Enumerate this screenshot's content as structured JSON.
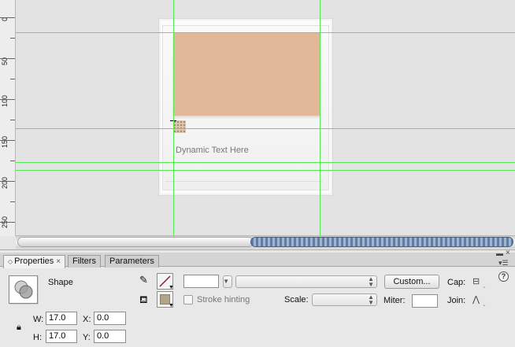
{
  "ruler": {
    "labels": [
      "0",
      "50",
      "100",
      "150",
      "200",
      "250"
    ]
  },
  "stage": {
    "dynamic_text": "Dynamic Text Here"
  },
  "panel": {
    "tabs": [
      {
        "label": "Properties",
        "active": true,
        "closable": true
      },
      {
        "label": "Filters",
        "active": false
      },
      {
        "label": "Parameters",
        "active": false
      }
    ],
    "close_glyph": "×",
    "object_type": "Shape",
    "stroke_hinting_label": "Stroke hinting",
    "scale_label": "Scale:",
    "custom_button": "Custom...",
    "cap_label": "Cap:",
    "miter_label": "Miter:",
    "join_label": "Join:",
    "help_glyph": "?",
    "w_label": "W:",
    "w_value": "17.0",
    "h_label": "H:",
    "h_value": "17.0",
    "x_label": "X:",
    "x_value": "0.0",
    "y_label": "Y:",
    "y_value": "0.0",
    "stroke_color": "#8a1c2e",
    "fill_color": "#b2a48a"
  },
  "colors": {
    "guide": "#55e855",
    "photo": "#e2b89b",
    "scroll_thumb": "#5e7ea9"
  },
  "icons": [
    "pencil-icon",
    "paint-bucket-icon",
    "lock-icon",
    "help-icon",
    "close-icon",
    "panel-menu-icon",
    "cap-icon",
    "join-icon"
  ]
}
